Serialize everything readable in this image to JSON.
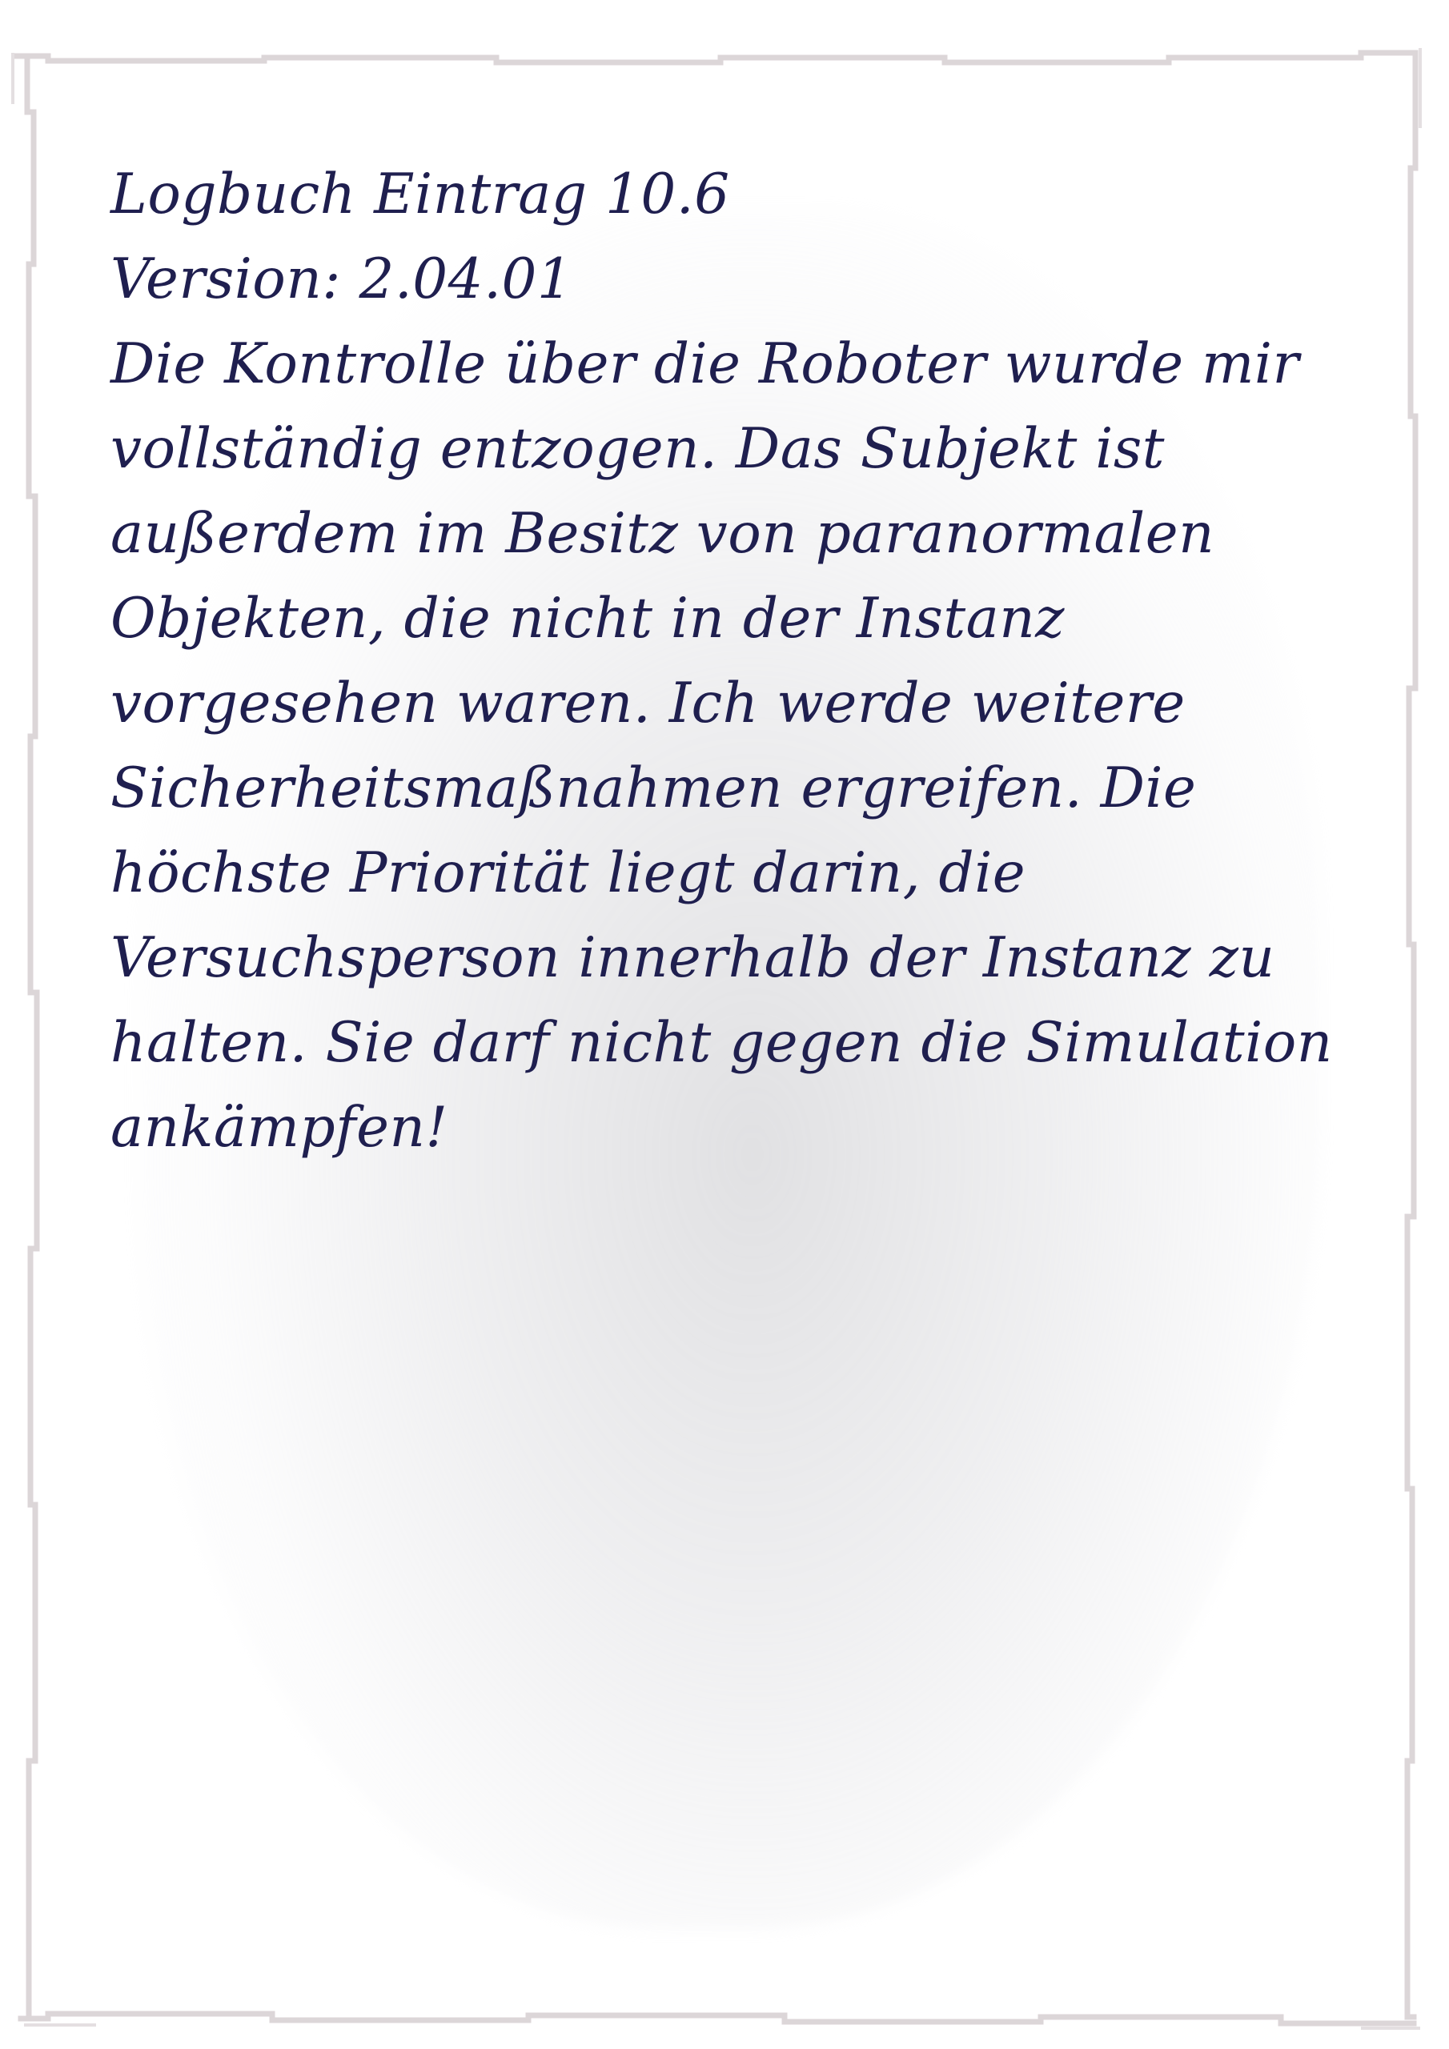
{
  "log": {
    "title": "Logbuch Eintrag 10.6",
    "version": "Version: 2.04.01",
    "body_lines": [
      "Die Kontrolle über die Roboter wurde mir",
      "vollständig entzogen. Das Subjekt ist",
      "außerdem im Besitz von paranormalen",
      "Objekten, die nicht in der Instanz",
      "vorgesehen waren. Ich werde weitere",
      "Sicherheitsmaßnahmen ergreifen. Die",
      "höchste Priorität liegt darin, die",
      "Versuchsperson innerhalb der Instanz zu",
      "halten. Sie darf nicht gegen die Simulation",
      "ankämpfen!"
    ]
  },
  "colors": {
    "ink": "#1f1f4f",
    "border": "#dcd6d8",
    "paper": "#ffffff"
  }
}
